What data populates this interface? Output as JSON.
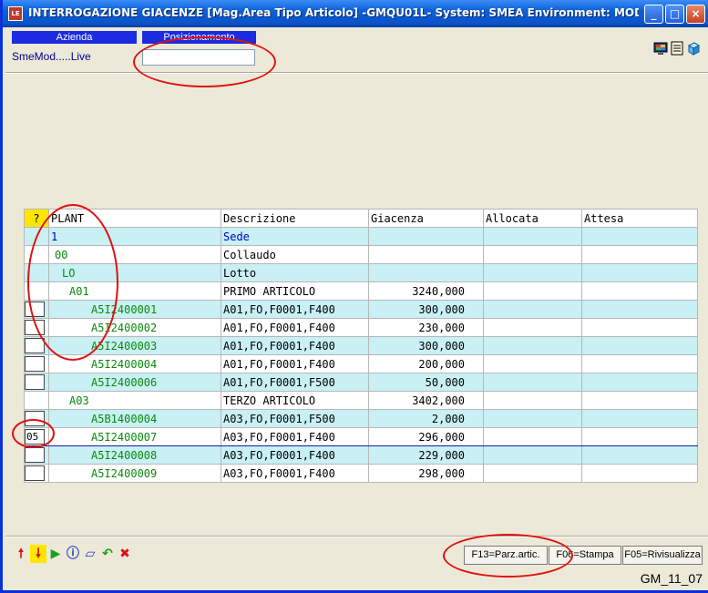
{
  "window": {
    "title": "INTERROGAZIONE GIACENZE [Mag.Area Tipo Articolo] -GMQU01L- System: SMEA Environment: MOD User: G...",
    "app_icon_text": "LE",
    "min_glyph": "_",
    "max_glyph": "□",
    "close_glyph": "×"
  },
  "header": {
    "azienda_label": "Azienda",
    "azienda_value": "SmeMod.....Live",
    "posizionamento_label": "Posizionamento",
    "posizionamento_value": ""
  },
  "grid": {
    "header": {
      "q": "?",
      "plant": "PLANT",
      "desc": "Descrizione",
      "giac": "Giacenza",
      "alloc": "Allocata",
      "attesa": "Attesa"
    },
    "rows": [
      {
        "cb": false,
        "plant": "1",
        "desc": "Sede",
        "giac": ""
      },
      {
        "cb": false,
        "plant": "00",
        "desc": "Collaudo",
        "giac": ""
      },
      {
        "cb": false,
        "plant": "LO",
        "desc": "Lotto",
        "giac": ""
      },
      {
        "cb": false,
        "plant": "A01",
        "desc": "PRIMO ARTICOLO",
        "giac": "3240,000"
      },
      {
        "cb": true,
        "cbval": "",
        "plant": "A5I2400001",
        "desc": "A01,FO,F0001,F400",
        "giac": "300,000"
      },
      {
        "cb": true,
        "cbval": "",
        "plant": "A5I2400002",
        "desc": "A01,FO,F0001,F400",
        "giac": "230,000"
      },
      {
        "cb": true,
        "cbval": "",
        "plant": "A5I2400003",
        "desc": "A01,FO,F0001,F400",
        "giac": "300,000"
      },
      {
        "cb": true,
        "cbval": "",
        "plant": "A5I2400004",
        "desc": "A01,FO,F0001,F400",
        "giac": "200,000"
      },
      {
        "cb": true,
        "cbval": "",
        "plant": "A5I2400006",
        "desc": "A01,FO,F0001,F500",
        "giac": "50,000"
      },
      {
        "cb": false,
        "plant": "A03",
        "desc": "TERZO ARTICOLO",
        "giac": "3402,000"
      },
      {
        "cb": true,
        "cbval": "",
        "plant": "A5B1400004",
        "desc": "A03,FO,F0001,F500",
        "giac": "2,000"
      },
      {
        "cb": true,
        "cbval": "05",
        "plant": "A5I2400007",
        "desc": "A03,FO,F0001,F400",
        "giac": "296,000"
      },
      {
        "cb": true,
        "cbval": "",
        "plant": "A5I2400008",
        "desc": "A03,FO,F0001,F400",
        "giac": "229,000"
      },
      {
        "cb": true,
        "cbval": "",
        "plant": "A5I2400009",
        "desc": "A03,FO,F0001,F400",
        "giac": "298,000"
      }
    ]
  },
  "buttons": {
    "f13": "F13=Parz.artic.",
    "f06": "F06=Stampa",
    "f05": "F05=Rivisualizza"
  },
  "toolbar_icons": [
    "arrow-up-icon",
    "arrow-down-icon",
    "play-icon",
    "info-icon",
    "eraser-icon",
    "refresh-arrow-icon",
    "cancel-x-icon"
  ],
  "status": {
    "code": "GM_11_07"
  },
  "colors": {
    "title_blue": "#0a5fd8",
    "header_label_blue": "#1a2be0",
    "row_cyan": "#c9f0f5",
    "plant_green": "#0a8a0a",
    "annotation_red": "#e01010"
  }
}
